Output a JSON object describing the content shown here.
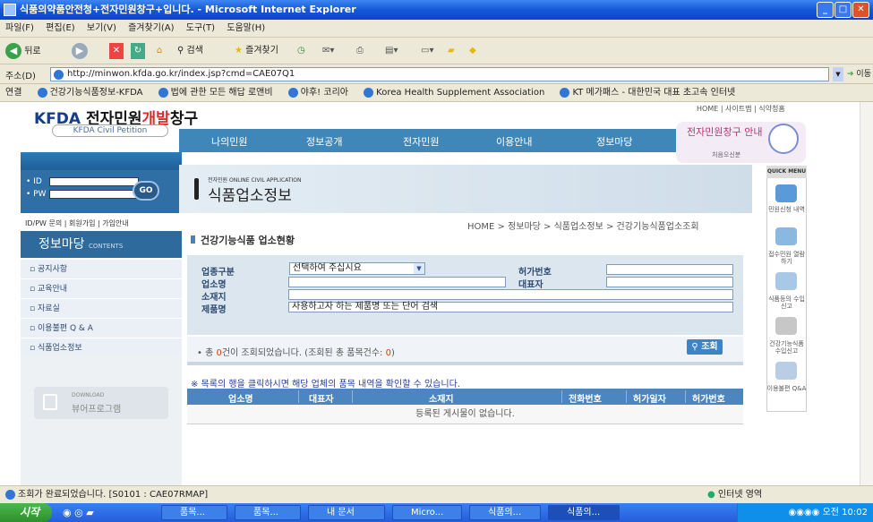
{
  "window": {
    "title": "식품의약품안전청+전자민원창구+입니다. - Microsoft Internet Explorer"
  },
  "menubar": [
    "파일(F)",
    "편집(E)",
    "보기(V)",
    "즐겨찾기(A)",
    "도구(T)",
    "도움말(H)"
  ],
  "toolbar": {
    "back": "뒤로",
    "search": "검색",
    "favorites": "즐겨찾기"
  },
  "address": {
    "label": "주소(D)",
    "url": "http://minwon.kfda.go.kr/index.jsp?cmd=CAE07Q1",
    "go": "이동"
  },
  "links": {
    "label": "연결",
    "items": [
      "건강기능식품정보-KFDA",
      "법에 관한 모든 해답 로앤비",
      "야후! 코리아",
      "Korea Health Supplement Association",
      "KT 메가패스 - 대한민국 대표 초고속 인터넷"
    ]
  },
  "site": {
    "logo_kfda": "KFDA",
    "logo_text1": "전자민원",
    "logo_text2": "개발",
    "logo_text3": "창구",
    "logo_sub": "KFDA Civil Petition",
    "toplinks": "HOME | 사이트맵 | 식약청홈",
    "nav": [
      "나의민원",
      "정보공개",
      "전자민원",
      "이용안내",
      "정보마당"
    ],
    "banner_text": "전자민원창구 안내",
    "banner_sub": "처음오신분"
  },
  "login": {
    "id_label": "• ID",
    "pw_label": "• PW",
    "go": "GO",
    "links": "ID/PW 문의 | 회원가입 | 가입안내"
  },
  "sidebar": {
    "title": "정보마당",
    "title_en": "CONTENTS",
    "items": [
      "공지사항",
      "교육안내",
      "자료실",
      "이용불편 Q & A",
      "식품업소정보"
    ],
    "download_small": "DOWNLOAD",
    "download_label": "뷰어프로그램"
  },
  "content": {
    "banner_small": "전자민원 ONLINE CIVIL APPLICATION",
    "banner_title": "식품업소정보",
    "breadcrumb": "HOME > 정보마당 > 식품업소정보 > 건강기능식품업소조회",
    "section_title": "건강기능식품 업소현황"
  },
  "form": {
    "biz_type_label": "업종구분",
    "biz_type_value": "선택하여 주십시요",
    "permit_no_label": "허가번호",
    "permit_no_value": "",
    "shop_name_label": "업소명",
    "shop_name_value": "",
    "ceo_label": "대표자",
    "ceo_value": "",
    "address_label": "소재지",
    "address_value": "",
    "product_label": "제품명",
    "product_placeholder": "사용하고자 하는 제품명 또는 단어 검색"
  },
  "results": {
    "count_prefix": "• 총 ",
    "count": "0",
    "count_mid": "건이 조회되었습니다. (조회된 총 품목건수: ",
    "item_count": "0",
    "count_suffix": ")",
    "search_button": "조회",
    "notice": "※ 목록의 행을 클릭하시면 해당 업체의 품목 내역을 확인할 수 있습니다.",
    "columns": [
      "업소명",
      "대표자",
      "소재지",
      "전화번호",
      "허가일자",
      "허가번호"
    ],
    "empty": "등록된 게시물이 없습니다."
  },
  "quickmenu": {
    "title": "QUICK MENU",
    "items": [
      "민원신청 내역",
      "접수민원 열람하기",
      "식품등의 수입신고",
      "건강기능식품 수입신고",
      "이용불편 Q&A"
    ]
  },
  "statusbar": {
    "text": "조회가 완료되었습니다. [S0101 : CAE07RMAP]",
    "zone": "인터넷 영역"
  },
  "taskbar": {
    "start": "시작",
    "tasks": [
      "품목...",
      "품목...",
      "내 문서",
      "Micro...",
      "식품의...",
      "식품의..."
    ],
    "clock": "오전 10:02"
  }
}
